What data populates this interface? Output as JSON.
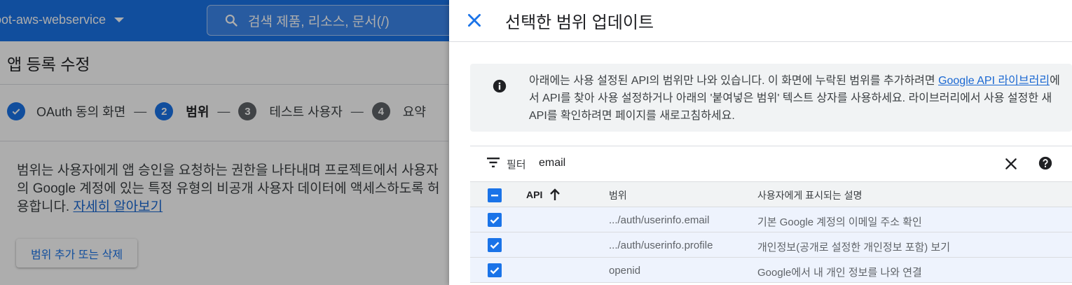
{
  "header": {
    "project_name": "oot-aws-webservice",
    "search_placeholder": "검색   제품, 리소스, 문서(/)"
  },
  "page": {
    "title": "앱 등록 수정",
    "steps": [
      {
        "number": "",
        "label": "OAuth 동의 화면",
        "state": "done"
      },
      {
        "number": "2",
        "label": "범위",
        "state": "active"
      },
      {
        "number": "3",
        "label": "테스트 사용자",
        "state": "pending"
      },
      {
        "number": "4",
        "label": "요약",
        "state": "pending"
      }
    ],
    "step_separator": "—",
    "description": "범위는 사용자에게 앱 승인을 요청하는 권한을 나타내며 프로젝트에서 사용자의 Google 계정에 있는 특정 유형의 비공개 사용자 데이터에 액세스하도록 허용합니다.",
    "learn_more": "자세히 알아보기",
    "add_remove_button": "범위 추가 또는 삭제"
  },
  "panel": {
    "title": "선택한 범위 업데이트",
    "info": {
      "text_before": "아래에는 사용 설정된 API의 범위만 나와 있습니다. 이 화면에 누락된 범위를 추가하려면 ",
      "link": "Google API 라이브러리",
      "text_after": "에서 API를 찾아 사용 설정하거나 아래의 '붙여넣은 범위' 텍스트 상자를 사용하세요. 라이브러리에서 사용 설정한 새 API를 확인하려면 페이지를 새로고침하세요."
    },
    "filter": {
      "label": "필터",
      "value": "email"
    },
    "table": {
      "headers": {
        "api": "API",
        "scope": "범위",
        "description": "사용자에게 표시되는 설명"
      },
      "rows": [
        {
          "api": "",
          "scope": ".../auth/userinfo.email",
          "description": "기본 Google 계정의 이메일 주소 확인",
          "checked": true
        },
        {
          "api": "",
          "scope": ".../auth/userinfo.profile",
          "description": "개인정보(공개로 설정한 개인정보 포함) 보기",
          "checked": true
        },
        {
          "api": "",
          "scope": "openid",
          "description": "Google에서 내 개인 정보를 나와 연결",
          "checked": true
        }
      ]
    }
  },
  "colors": {
    "brand_blue": "#1a73e8",
    "link_blue": "#1967d2",
    "step_pending": "#5f6368",
    "row_selected": "#eef3fd"
  }
}
